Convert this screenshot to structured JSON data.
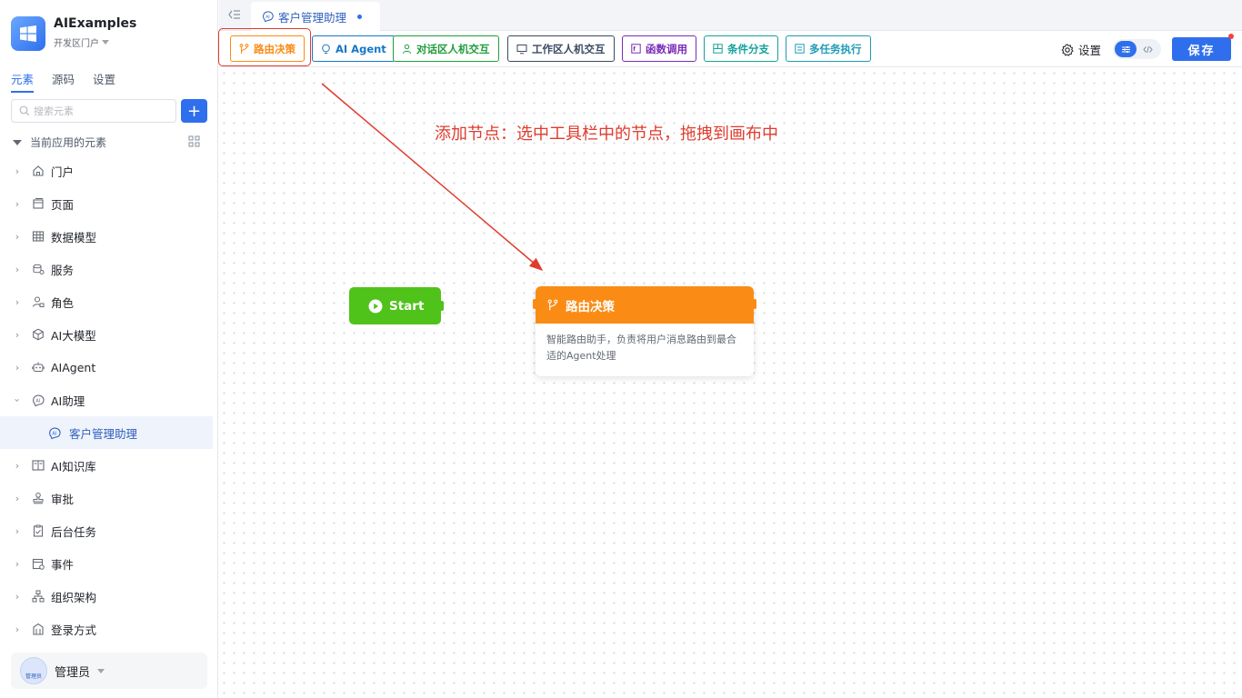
{
  "app": {
    "name": "AIExamples",
    "portal": "开发区门户"
  },
  "side_tabs": [
    {
      "label": "元素",
      "active": true
    },
    {
      "label": "源码",
      "active": false
    },
    {
      "label": "设置",
      "active": false
    }
  ],
  "search": {
    "placeholder": "搜索元素",
    "value": ""
  },
  "tree_header": "当前应用的元素",
  "tree": [
    {
      "label": "门户",
      "icon": "home-icon",
      "expanded": false
    },
    {
      "label": "页面",
      "icon": "page-icon",
      "expanded": false
    },
    {
      "label": "数据模型",
      "icon": "table-icon",
      "expanded": false
    },
    {
      "label": "服务",
      "icon": "service-icon",
      "expanded": false
    },
    {
      "label": "角色",
      "icon": "role-icon",
      "expanded": false
    },
    {
      "label": "AI大模型",
      "icon": "model-icon",
      "expanded": false
    },
    {
      "label": "AIAgent",
      "icon": "robot-icon",
      "expanded": false
    },
    {
      "label": "AI助理",
      "icon": "ai-assistant-icon",
      "expanded": true
    },
    {
      "label": "客户管理助理",
      "icon": "ai-assistant-icon",
      "child": true
    },
    {
      "label": "AI知识库",
      "icon": "book-icon",
      "expanded": false
    },
    {
      "label": "审批",
      "icon": "stamp-icon",
      "expanded": false
    },
    {
      "label": "后台任务",
      "icon": "task-icon",
      "expanded": false
    },
    {
      "label": "事件",
      "icon": "event-icon",
      "expanded": false
    },
    {
      "label": "组织架构",
      "icon": "org-icon",
      "expanded": false
    },
    {
      "label": "登录方式",
      "icon": "login-icon",
      "expanded": false
    }
  ],
  "user": {
    "name": "管理员",
    "avatar_text": "管理员"
  },
  "doc_tab": {
    "label": "客户管理助理"
  },
  "toolbar": {
    "buttons": [
      {
        "label": "路由决策",
        "color": "#fa8c16",
        "icon": "branch-icon",
        "highlighted": true
      },
      {
        "label": "AI Agent",
        "color": "#1677c8",
        "icon": "bulb-icon"
      },
      {
        "label": "对话区人机交互",
        "color": "#1f9d3a",
        "icon": "user-icon"
      },
      {
        "label": "工作区人机交互",
        "color": "#3a4a63",
        "icon": "monitor-icon"
      },
      {
        "label": "函数调用",
        "color": "#7a2bb8",
        "icon": "function-icon"
      },
      {
        "label": "条件分支",
        "color": "#13a39a",
        "icon": "condition-icon"
      },
      {
        "label": "多任务执行",
        "color": "#1e9bb5",
        "icon": "multitask-icon"
      }
    ],
    "settings_label": "设置",
    "save_label": "保存"
  },
  "canvas": {
    "tip": "添加节点：选中工具栏中的节点，拖拽到画布中",
    "start_node": {
      "label": "Start"
    },
    "route_node": {
      "title": "路由决策",
      "description": "智能路由助手，负责将用户消息路由到最合适的Agent处理"
    }
  },
  "colors": {
    "accent": "#2f6fed",
    "annotation": "#e03b2d",
    "start": "#4fc31a",
    "route": "#fa8c16"
  }
}
